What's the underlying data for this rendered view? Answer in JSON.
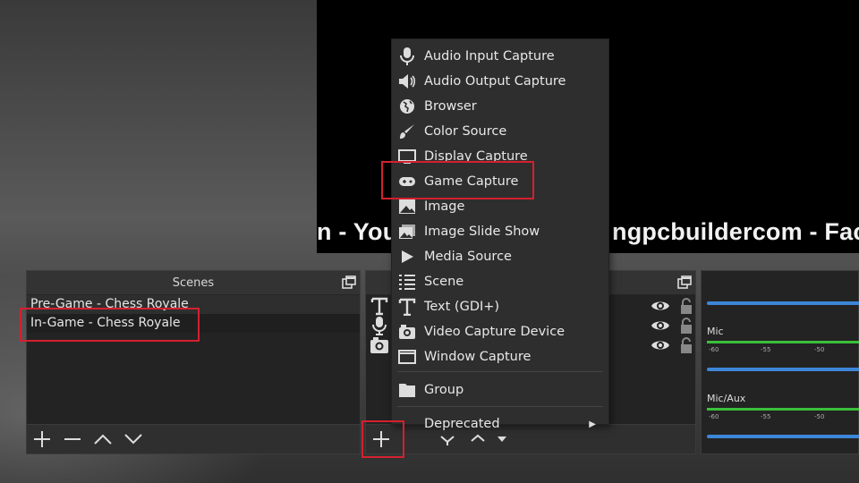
{
  "preview": {
    "ticker_left": "n - You",
    "ticker_mid": "ngpcbuildercom - Fac"
  },
  "scenes": {
    "title": "Scenes",
    "items": [
      "Pre-Game - Chess Royale",
      "In-Game - Chess Royale"
    ],
    "selected_index": 1
  },
  "sources": {
    "items": [
      {
        "icon": "text-icon"
      },
      {
        "icon": "microphone-icon"
      },
      {
        "icon": "camera-icon"
      }
    ]
  },
  "mixer": {
    "tracks": [
      {
        "label": ""
      },
      {
        "label": "Mic"
      },
      {
        "label": "Mic/Aux"
      }
    ],
    "ticks": [
      "-60",
      "-55",
      "-50"
    ]
  },
  "context_menu": {
    "items": [
      {
        "label": "Audio Input Capture",
        "icon": "microphone-icon"
      },
      {
        "label": "Audio Output Capture",
        "icon": "speaker-icon"
      },
      {
        "label": "Browser",
        "icon": "globe-icon"
      },
      {
        "label": "Color Source",
        "icon": "brush-icon"
      },
      {
        "label": "Display Capture",
        "icon": "monitor-icon"
      },
      {
        "label": "Game Capture",
        "icon": "gamepad-icon"
      },
      {
        "label": "Image",
        "icon": "image-icon"
      },
      {
        "label": "Image Slide Show",
        "icon": "slideshow-icon"
      },
      {
        "label": "Media Source",
        "icon": "play-icon"
      },
      {
        "label": "Scene",
        "icon": "list-icon"
      },
      {
        "label": "Text (GDI+)",
        "icon": "text-icon"
      },
      {
        "label": "Video Capture Device",
        "icon": "camera-icon"
      },
      {
        "label": "Window Capture",
        "icon": "window-icon"
      }
    ],
    "group_label": "Group",
    "deprecated_label": "Deprecated"
  },
  "colors": {
    "highlight": "#d4202f",
    "meter_blue": "#3d86d8",
    "meter_green": "#3bbf3b"
  }
}
